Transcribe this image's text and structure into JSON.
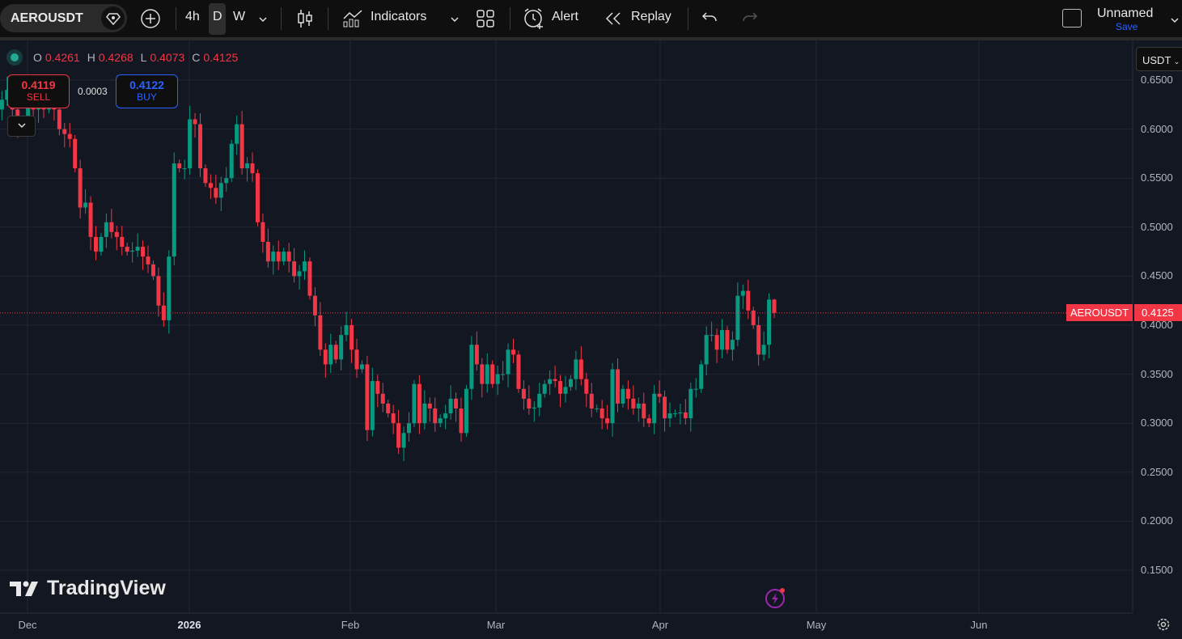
{
  "toolbar": {
    "symbol": "AEROUSDT",
    "intervals": [
      "4h",
      "D",
      "W"
    ],
    "selected_interval": "D",
    "indicators_label": "Indicators",
    "alert_label": "Alert",
    "replay_label": "Replay",
    "layout_name": "Unnamed",
    "save_label": "Save"
  },
  "legend": {
    "o_label": "O",
    "o": "0.4261",
    "h_label": "H",
    "h": "0.4268",
    "l_label": "L",
    "l": "0.4073",
    "c_label": "C",
    "c": "0.4125"
  },
  "trade": {
    "sell_price": "0.4119",
    "sell_label": "SELL",
    "spread": "0.0003",
    "buy_price": "0.4122",
    "buy_label": "BUY"
  },
  "currency": "USDT",
  "price_tag": {
    "symbol": "AEROUSDT",
    "price": "0.4125"
  },
  "brand": "TradingView",
  "colors": {
    "up": "#089981",
    "down": "#f23645",
    "background": "#131722"
  },
  "chart_data": {
    "type": "candlestick",
    "symbol": "AEROUSDT",
    "interval": "D",
    "start_date": "2025-11-26",
    "closes": [
      0.62,
      0.63,
      0.64,
      0.62,
      0.6,
      0.61,
      0.63,
      0.62,
      0.64,
      0.62,
      0.63,
      0.62,
      0.6,
      0.595,
      0.59,
      0.56,
      0.52,
      0.525,
      0.49,
      0.475,
      0.49,
      0.505,
      0.495,
      0.49,
      0.48,
      0.475,
      0.476,
      0.48,
      0.47,
      0.462,
      0.45,
      0.42,
      0.405,
      0.47,
      0.565,
      0.56,
      0.56,
      0.61,
      0.605,
      0.56,
      0.545,
      0.54,
      0.53,
      0.545,
      0.55,
      0.585,
      0.605,
      0.56,
      0.565,
      0.555,
      0.505,
      0.485,
      0.465,
      0.475,
      0.465,
      0.475,
      0.465,
      0.45,
      0.455,
      0.465,
      0.43,
      0.41,
      0.375,
      0.36,
      0.38,
      0.365,
      0.39,
      0.4,
      0.375,
      0.355,
      0.36,
      0.293,
      0.343,
      0.33,
      0.32,
      0.31,
      0.3,
      0.275,
      0.29,
      0.3,
      0.34,
      0.3,
      0.32,
      0.315,
      0.3,
      0.305,
      0.31,
      0.325,
      0.315,
      0.29,
      0.335,
      0.38,
      0.36,
      0.34,
      0.36,
      0.34,
      0.35,
      0.35,
      0.375,
      0.37,
      0.335,
      0.325,
      0.315,
      0.316,
      0.33,
      0.34,
      0.345,
      0.343,
      0.33,
      0.337,
      0.345,
      0.365,
      0.345,
      0.33,
      0.315,
      0.315,
      0.305,
      0.3,
      0.355,
      0.32,
      0.335,
      0.325,
      0.315,
      0.32,
      0.305,
      0.3,
      0.33,
      0.327,
      0.305,
      0.31,
      0.31,
      0.311,
      0.305,
      0.335,
      0.335,
      0.36,
      0.39,
      0.39,
      0.375,
      0.395,
      0.375,
      0.385,
      0.43,
      0.435,
      0.415,
      0.4,
      0.37,
      0.38,
      0.4261,
      0.4125
    ],
    "last": {
      "open": 0.4261,
      "high": 0.4268,
      "low": 0.4073,
      "close": 0.4125
    },
    "y_ticks": [
      "0.6500",
      "0.6000",
      "0.5500",
      "0.5000",
      "0.4500",
      "0.4000",
      "0.3500",
      "0.3000",
      "0.2500",
      "0.2000",
      "0.1500"
    ],
    "x_ticks": [
      "Dec",
      "2026",
      "Feb",
      "Mar",
      "Apr",
      "May",
      "Jun"
    ],
    "ylim": [
      0.15,
      0.65
    ],
    "current_price": 0.4125
  }
}
